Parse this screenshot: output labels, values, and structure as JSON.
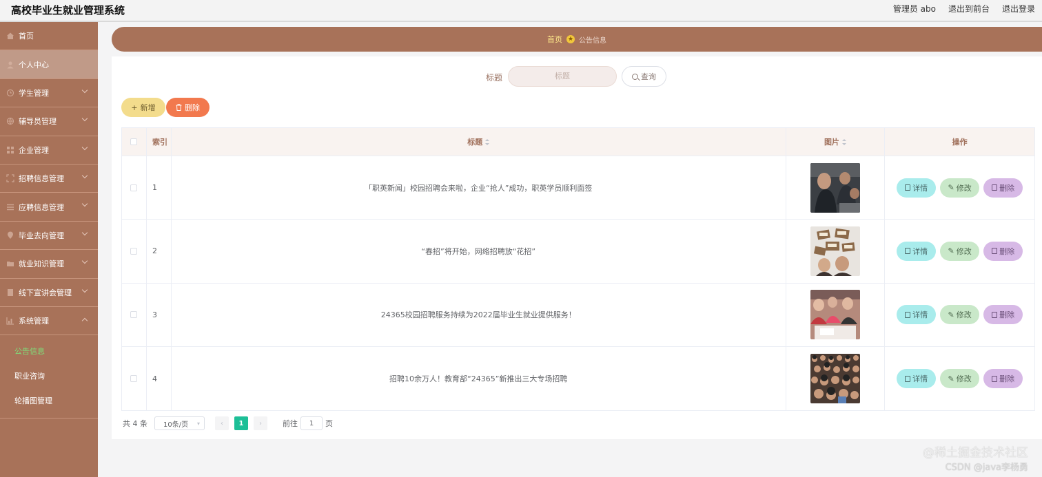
{
  "header": {
    "title": "高校毕业生就业管理系统",
    "user": "管理员 abo",
    "to_front": "退出到前台",
    "logout": "退出登录"
  },
  "sidebar": {
    "items": [
      {
        "label": "首页",
        "icon": "home-icon"
      },
      {
        "label": "个人中心",
        "icon": "user-icon"
      },
      {
        "label": "学生管理",
        "icon": "clock-icon"
      },
      {
        "label": "辅导员管理",
        "icon": "globe-icon"
      },
      {
        "label": "企业管理",
        "icon": "grid-icon"
      },
      {
        "label": "招聘信息管理",
        "icon": "frame-icon"
      },
      {
        "label": "应聘信息管理",
        "icon": "list-icon"
      },
      {
        "label": "毕业去向管理",
        "icon": "pin-icon"
      },
      {
        "label": "就业知识管理",
        "icon": "folder-icon"
      },
      {
        "label": "线下宣讲会管理",
        "icon": "doc-icon"
      },
      {
        "label": "系统管理",
        "icon": "chart-icon"
      }
    ],
    "sub_items": [
      "公告信息",
      "职业咨询",
      "轮播图管理"
    ]
  },
  "breadcrumb": {
    "home": "首页",
    "current": "公告信息"
  },
  "search": {
    "label": "标题",
    "placeholder": "标题",
    "button": "查询"
  },
  "actions": {
    "add": "新增",
    "delete": "删除"
  },
  "table": {
    "headers": {
      "index": "索引",
      "title": "标题",
      "image": "图片",
      "ops": "操作"
    },
    "rows": [
      {
        "index": "1",
        "title": "「职英新闻」校园招聘会来啦，企业“抢人”成功，职英学员顺利面签",
        "thumb": "photo-crowd-dark"
      },
      {
        "index": "2",
        "title": "“春招”将开始，网络招聘放“花招”",
        "thumb": "photo-signs"
      },
      {
        "index": "3",
        "title": "24365校园招聘服务持续为2022届毕业生就业提供服务！",
        "thumb": "photo-students"
      },
      {
        "index": "4",
        "title": "招聘10余万人！教育部“24365”新推出三大专场招聘",
        "thumb": "photo-crowd"
      }
    ],
    "op_labels": {
      "detail": "详情",
      "edit": "修改",
      "remove": "删除"
    }
  },
  "pagination": {
    "total": "共 4 条",
    "page_size": "10条/页",
    "current_page": "1",
    "goto_prefix": "前往",
    "goto_value": "1",
    "goto_suffix": "页"
  },
  "watermark": {
    "line1": "@稀土掘金技术社区",
    "line2": "CSDN @java李杨勇"
  },
  "colors": {
    "sidebar": "#a87259",
    "accent_green": "#1dbf97",
    "delete_orange": "#f2794e",
    "add_yellow": "#f3dc8c"
  }
}
